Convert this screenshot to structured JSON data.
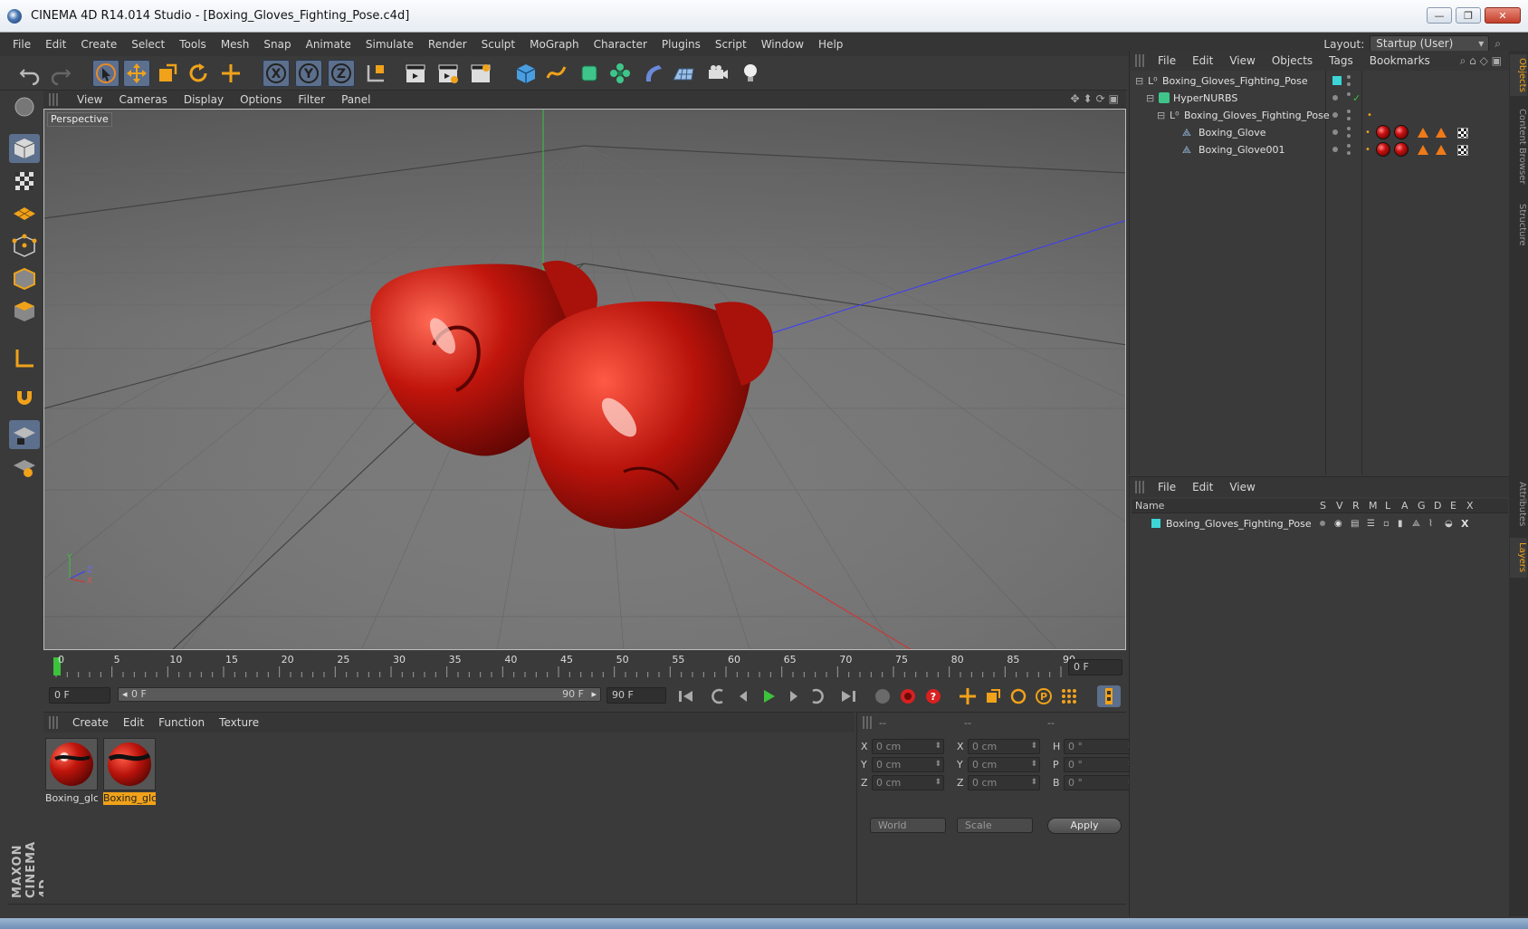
{
  "window": {
    "title": "CINEMA 4D R14.014 Studio - [Boxing_Gloves_Fighting_Pose.c4d]",
    "minimize": "—",
    "restore": "❐",
    "close": "✕"
  },
  "menu": [
    "File",
    "Edit",
    "Create",
    "Select",
    "Tools",
    "Mesh",
    "Snap",
    "Animate",
    "Simulate",
    "Render",
    "Sculpt",
    "MoGraph",
    "Character",
    "Plugins",
    "Script",
    "Window",
    "Help"
  ],
  "layout": {
    "label": "Layout:",
    "value": "Startup (User)"
  },
  "viewport": {
    "menu": [
      "View",
      "Cameras",
      "Display",
      "Options",
      "Filter",
      "Panel"
    ],
    "label": "Perspective",
    "axis": {
      "y": "Y",
      "z": "Z",
      "x": "X"
    }
  },
  "timeline": {
    "ticks": [
      "0",
      "5",
      "10",
      "15",
      "20",
      "25",
      "30",
      "35",
      "40",
      "45",
      "50",
      "55",
      "60",
      "65",
      "70",
      "75",
      "80",
      "85",
      "90"
    ],
    "current_frame": "0 F",
    "start_field": "0 F",
    "range_start": "0 F",
    "range_end": "90 F",
    "end_field": "90 F"
  },
  "materials": {
    "menu": [
      "Create",
      "Edit",
      "Function",
      "Texture"
    ],
    "items": [
      {
        "label": "Boxing_glc",
        "selected": false
      },
      {
        "label": "Boxing_glc",
        "selected": true
      }
    ]
  },
  "coordinates": {
    "head": [
      "--",
      "--",
      "--"
    ],
    "rows": [
      {
        "p_lbl": "X",
        "p_val": "0 cm",
        "s_lbl": "X",
        "s_val": "0 cm",
        "r_lbl": "H",
        "r_val": "0 °"
      },
      {
        "p_lbl": "Y",
        "p_val": "0 cm",
        "s_lbl": "Y",
        "s_val": "0 cm",
        "r_lbl": "P",
        "r_val": "0 °"
      },
      {
        "p_lbl": "Z",
        "p_val": "0 cm",
        "s_lbl": "Z",
        "s_val": "0 cm",
        "r_lbl": "B",
        "r_val": "0 °"
      }
    ],
    "space": "World",
    "mode": "Scale",
    "apply": "Apply"
  },
  "objects": {
    "menu": [
      "File",
      "Edit",
      "View",
      "Objects",
      "Tags",
      "Bookmarks"
    ],
    "tree": [
      {
        "name": "Boxing_Gloves_Fighting_Pose"
      },
      {
        "name": "HyperNURBS"
      },
      {
        "name": "Boxing_Gloves_Fighting_Pose"
      },
      {
        "name": "Boxing_Glove"
      },
      {
        "name": "Boxing_Glove001"
      }
    ]
  },
  "layers": {
    "menu": [
      "File",
      "Edit",
      "View"
    ],
    "columns": [
      "Name",
      "S",
      "V",
      "R",
      "M",
      "L",
      "A",
      "G",
      "D",
      "E",
      "X"
    ],
    "rows": [
      {
        "name": "Boxing_Gloves_Fighting_Pose"
      }
    ]
  },
  "side_tabs": [
    "Objects",
    "Content Browser",
    "Structure",
    "Attributes",
    "Layers"
  ],
  "logo": {
    "line1": "MAXON",
    "line2": "CINEMA 4D"
  },
  "colors": {
    "accent": "#f0a21a",
    "active_tool": "#5c6f8c",
    "glove": "#c0150c"
  }
}
